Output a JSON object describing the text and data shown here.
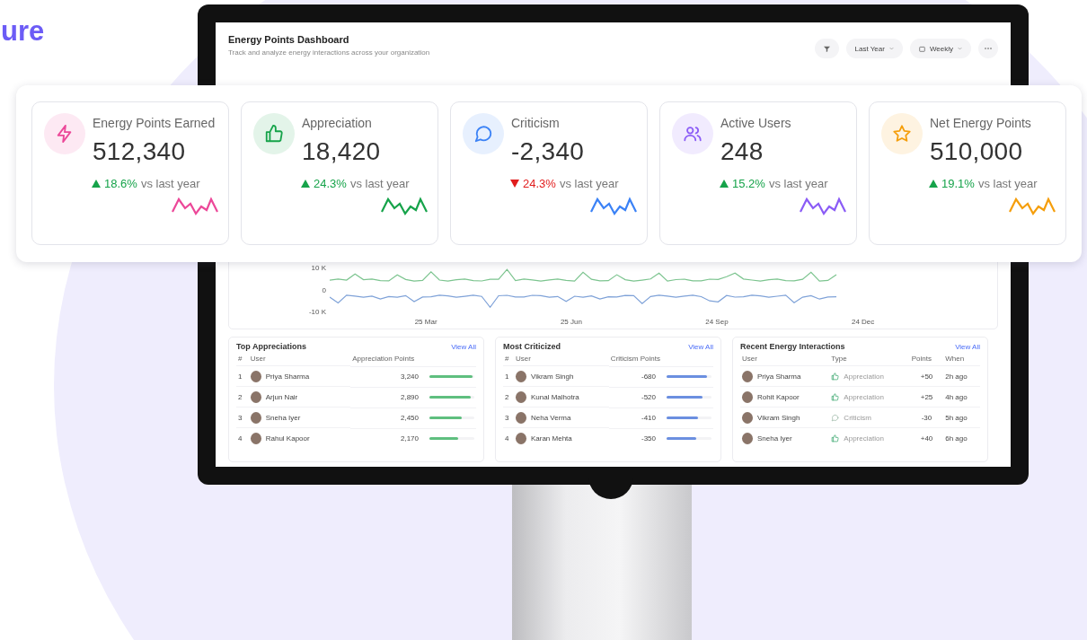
{
  "heading": {
    "text": "ure"
  },
  "dashboard": {
    "title": "Energy Points Dashboard",
    "subtitle": "Track and analyze energy interactions across your organization",
    "period": "Last Year",
    "interval": "Weekly"
  },
  "stats": [
    {
      "label": "Energy Points Earned",
      "value": "512,340",
      "change": "18.6%",
      "rising": true,
      "suffix": "vs last year",
      "kind": "bolt",
      "color": "#ec4899"
    },
    {
      "label": "Appreciation",
      "value": "18,420",
      "change": "24.3%",
      "rising": true,
      "suffix": "vs last year",
      "kind": "thumb",
      "color": "#16a34a"
    },
    {
      "label": "Criticism",
      "value": "-2,340",
      "change": "24.3%",
      "rising": false,
      "suffix": "vs last year",
      "kind": "chat",
      "color": "#3b82f6"
    },
    {
      "label": "Active Users",
      "value": "248",
      "change": "15.2%",
      "rising": true,
      "suffix": "vs last year",
      "kind": "users",
      "color": "#8b5cf6"
    },
    {
      "label": "Net Energy Points",
      "value": "510,000",
      "change": "19.1%",
      "rising": true,
      "suffix": "vs last year",
      "kind": "star",
      "color": "#f59e0b"
    }
  ],
  "trend_chart": {
    "yticks": [
      "10 K",
      "0",
      "-10 K"
    ],
    "xticks": [
      "25 Mar",
      "25 Jun",
      "24 Sep",
      "24 Dec"
    ]
  },
  "top_appreciations": {
    "title": "Top Appreciations",
    "link": "View All",
    "columns": [
      "#",
      "User",
      "Appreciation Points"
    ],
    "rows": [
      {
        "rank": "1",
        "user": "Priya Sharma",
        "points": "3,240",
        "level": 0.95
      },
      {
        "rank": "2",
        "user": "Arjun Nair",
        "points": "2,890",
        "level": 0.92
      },
      {
        "rank": "3",
        "user": "Sneha Iyer",
        "points": "2,450",
        "level": 0.72
      },
      {
        "rank": "4",
        "user": "Rahul Kapoor",
        "points": "2,170",
        "level": 0.64
      }
    ]
  },
  "most_criticized": {
    "title": "Most Criticized",
    "link": "View All",
    "columns": [
      "#",
      "User",
      "Criticism Points"
    ],
    "rows": [
      {
        "rank": "1",
        "user": "Vikram Singh",
        "points": "-680",
        "level": 0.9
      },
      {
        "rank": "2",
        "user": "Kunal Malhotra",
        "points": "-520",
        "level": 0.8
      },
      {
        "rank": "3",
        "user": "Neha Verma",
        "points": "-410",
        "level": 0.7
      },
      {
        "rank": "4",
        "user": "Karan Mehta",
        "points": "-350",
        "level": 0.66
      }
    ]
  },
  "recent_interactions": {
    "title": "Recent Energy Interactions",
    "link": "View All",
    "columns": [
      "User",
      "Type",
      "Points",
      "When"
    ],
    "rows": [
      {
        "user": "Priya Sharma",
        "kind": "appreciation",
        "type": "Appreciation",
        "points": "+50",
        "when": "2h ago"
      },
      {
        "user": "Rohit Kapoor",
        "kind": "appreciation",
        "type": "Appreciation",
        "points": "+25",
        "when": "4h ago"
      },
      {
        "user": "Vikram Singh",
        "kind": "criticism",
        "type": "Criticism",
        "points": "-30",
        "when": "5h ago"
      },
      {
        "user": "Sneha Iyer",
        "kind": "appreciation",
        "type": "Appreciation",
        "points": "+40",
        "when": "6h ago"
      }
    ]
  }
}
